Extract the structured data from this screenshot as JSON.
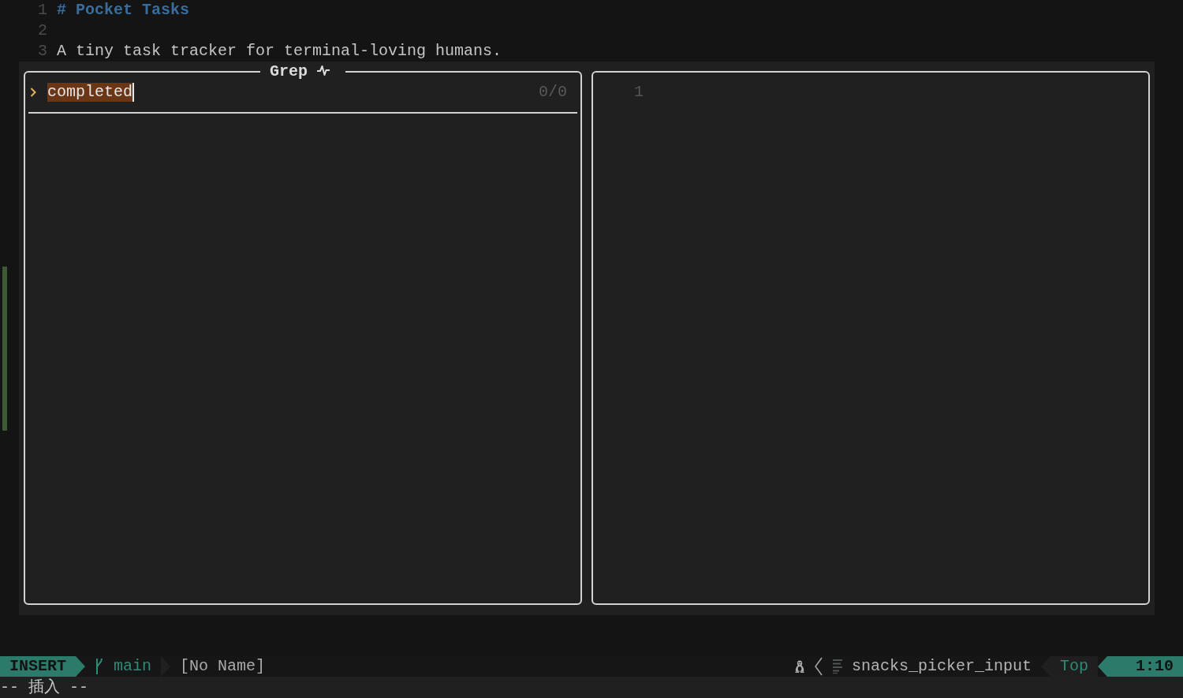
{
  "editor": {
    "sign": {
      "kind": "added"
    },
    "lines": [
      {
        "number": "1",
        "kind": "heading",
        "text": "# Pocket Tasks"
      },
      {
        "number": "2",
        "kind": "blank"
      },
      {
        "number": "3",
        "kind": "text",
        "text": "A tiny task tracker for terminal-loving humans."
      }
    ]
  },
  "picker": {
    "title": "Grep",
    "input": {
      "query": "completed",
      "highlighted": true
    },
    "count": "0/0",
    "preview": {
      "lines": [
        {
          "number": "1"
        }
      ]
    }
  },
  "statusline": {
    "mode": "INSERT",
    "branch": "main",
    "file": "[No Name]",
    "filetype": "snacks_picker_input",
    "scroll": "Top",
    "cursor": "1:10"
  },
  "cmdline": {
    "message": "-- 插入 --"
  }
}
